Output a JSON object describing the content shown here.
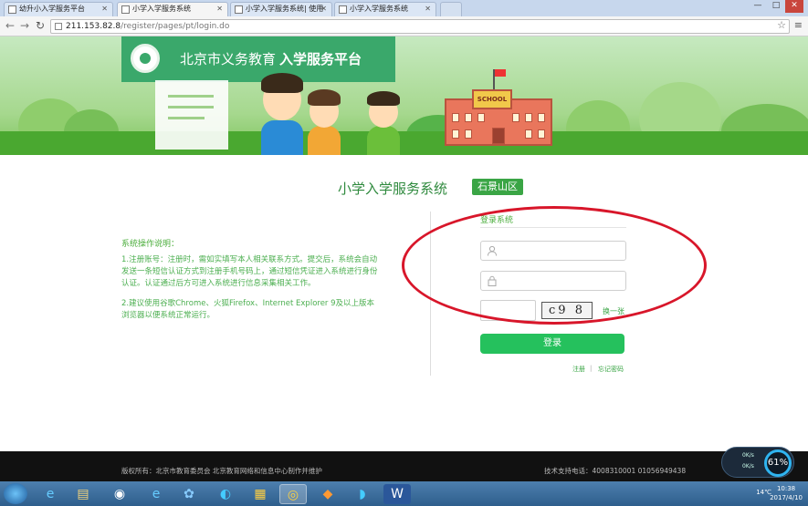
{
  "browser": {
    "tabs": [
      {
        "title": "幼升小入学服务平台"
      },
      {
        "title": "小学入学服务系统"
      },
      {
        "title": "小学入学服务系统| 使用"
      },
      {
        "title": "小学入学服务系统"
      }
    ],
    "url_host": "211.153.82.8",
    "url_path": "/register/pages/pt/login.do",
    "window_controls": [
      "—",
      "□",
      "✕"
    ]
  },
  "banner": {
    "logo_text": "北京市义务教育",
    "logo_text_bold": "入学服务平台",
    "school_sign": "SCHOOL"
  },
  "main": {
    "system_title": "小学入学服务系统",
    "district": "石景山区"
  },
  "help": {
    "title": "系统操作说明：",
    "p1": "1.注册账号：注册时，需如实填写本人相关联系方式。提交后，系统会自动发送一条短信认证方式到注册手机号码上，通过短信凭证进入系统进行身份认证。认证通过后方可进入系统进行信息采集相关工作。",
    "p2": "2.建议使用谷歌Chrome、火狐Firefox、Internet Explorer 9及以上版本浏览器以便系统正常运行。"
  },
  "login": {
    "title": "登录系统",
    "username_placeholder": "",
    "password_placeholder": "",
    "captcha_text": "c9 8",
    "refresh_label": "换一张",
    "submit_label": "登录",
    "register_label": "注册",
    "separator": "|",
    "forgot_label": "忘记密码"
  },
  "footer": {
    "copyright": "版权所有：北京市教育委员会 北京教育网络和信息中心制作并维护",
    "tech_support": "技术支持电话：4008310001  01056949438"
  },
  "net_widget": {
    "up": "0K/s",
    "down": "0K/s",
    "percent": "61%"
  },
  "taskbar": {
    "temperature": "14℃",
    "time": "10:38",
    "date": "2017/4/10"
  },
  "colors": {
    "brand_green": "#3aa545",
    "button_green": "#25c15d",
    "annotation_red": "#d8162a"
  }
}
